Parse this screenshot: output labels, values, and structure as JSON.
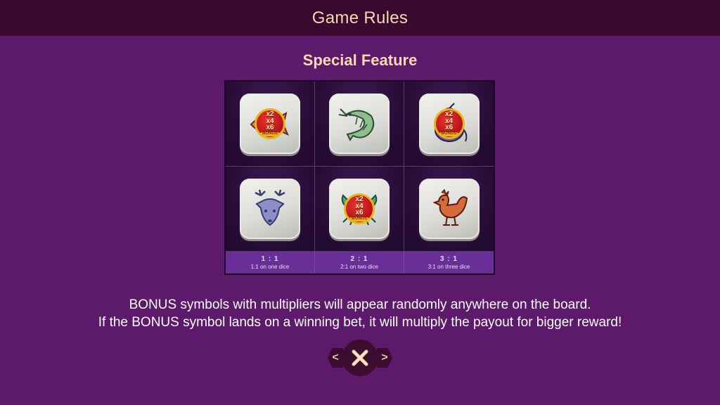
{
  "header": {
    "title": "Game Rules"
  },
  "section": {
    "title": "Special Feature"
  },
  "board": {
    "symbols": [
      {
        "name": "fish",
        "bonus": true
      },
      {
        "name": "shrimp",
        "bonus": false
      },
      {
        "name": "gourd",
        "bonus": true
      },
      {
        "name": "deer",
        "bonus": false
      },
      {
        "name": "crab",
        "bonus": true
      },
      {
        "name": "rooster",
        "bonus": false
      }
    ],
    "bonus_badge": {
      "m1": "x2",
      "m2": "x4",
      "m3": "x6",
      "label": "BONUS"
    },
    "odds": [
      {
        "ratio": "1 : 1",
        "desc": "1:1 on one dice"
      },
      {
        "ratio": "2 : 1",
        "desc": "2:1 on two dice"
      },
      {
        "ratio": "3 : 1",
        "desc": "3:1 on three dice"
      }
    ]
  },
  "description": {
    "line1": "BONUS symbols with multipliers will appear randomly anywhere on the board.",
    "line2": "If the BONUS symbol lands on a winning bet, it will multiply the payout for bigger reward!"
  },
  "nav": {
    "prev": "<",
    "next": ">"
  },
  "colors": {
    "background": "#5d1a6b",
    "header": "#3a0a2e",
    "title_text": "#f4d9b2",
    "odds_bar": "#6a2e98"
  }
}
